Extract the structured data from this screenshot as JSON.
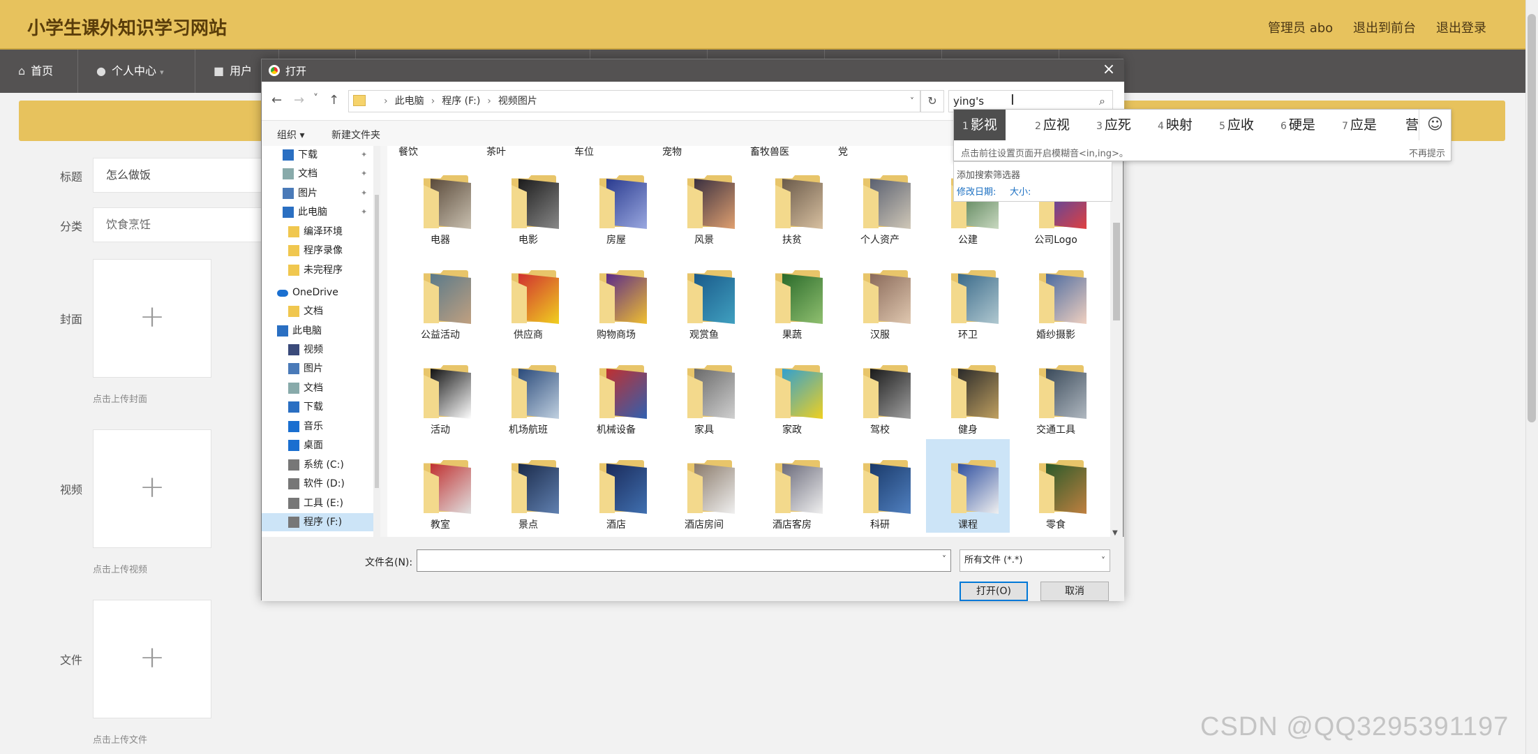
{
  "site": {
    "title": "小学生课外知识学习网站",
    "admin_label": "管理员 abo",
    "front_label": "退出到前台",
    "logout_label": "退出登录"
  },
  "nav": {
    "home": "首页",
    "personal": "个人中心",
    "users": "用户"
  },
  "form": {
    "title_label": "标题",
    "title_value": "怎么做饭",
    "category_label": "分类",
    "category_value": "饮食烹饪",
    "cover_label": "封面",
    "cover_hint": "点击上传封面",
    "video_label": "视频",
    "video_hint": "点击上传视频",
    "file_label": "文件",
    "file_hint": "点击上传文件",
    "plus": "+"
  },
  "dialog": {
    "title": "打开",
    "close": "×",
    "back": "←",
    "forward": "→",
    "recent": "˅",
    "up": "↑",
    "path": [
      "此电脑",
      "程序 (F:)",
      "视频图片"
    ],
    "path_sep": "›",
    "refresh": "↻",
    "search_value": "ying's",
    "organize": "组织 ▾",
    "new_folder": "新建文件夹",
    "sidebar": [
      {
        "label": "下载",
        "icon": "download-icon",
        "pinned": true
      },
      {
        "label": "文档",
        "icon": "document-icon",
        "pinned": true
      },
      {
        "label": "图片",
        "icon": "picture-icon",
        "pinned": true
      },
      {
        "label": "此电脑",
        "icon": "computer-icon",
        "pinned": true
      },
      {
        "label": "编泽环境",
        "icon": "folder-icon",
        "pinned": false
      },
      {
        "label": "程序录像",
        "icon": "folder-icon",
        "pinned": false
      },
      {
        "label": "未完程序",
        "icon": "folder-icon",
        "pinned": false
      },
      {
        "label": "OneDrive",
        "icon": "cloud-icon",
        "pinned": false
      },
      {
        "label": "文档",
        "icon": "folder-icon",
        "pinned": false
      },
      {
        "label": "此电脑",
        "icon": "computer-icon",
        "pinned": false
      },
      {
        "label": "视频",
        "icon": "video-icon",
        "pinned": false
      },
      {
        "label": "图片",
        "icon": "picture-icon",
        "pinned": false
      },
      {
        "label": "文档",
        "icon": "document-icon",
        "pinned": false
      },
      {
        "label": "下载",
        "icon": "download-icon",
        "pinned": false
      },
      {
        "label": "音乐",
        "icon": "music-icon",
        "pinned": false
      },
      {
        "label": "桌面",
        "icon": "desktop-icon",
        "pinned": false
      },
      {
        "label": "系统 (C:)",
        "icon": "drive-icon",
        "pinned": false
      },
      {
        "label": "软件 (D:)",
        "icon": "drive-icon",
        "pinned": false
      },
      {
        "label": "工具 (E:)",
        "icon": "drive-icon",
        "pinned": false
      },
      {
        "label": "程序 (F:)",
        "icon": "drive-icon",
        "pinned": false
      }
    ],
    "top_row": [
      "餐饮",
      "茶叶",
      "车位",
      "宠物",
      "畜牧兽医",
      "党"
    ],
    "folders": [
      {
        "name": "电器",
        "c1": "#5a4a3a",
        "c2": "#c9c0b0"
      },
      {
        "name": "电影",
        "c1": "#1b1b1b",
        "c2": "#888888"
      },
      {
        "name": "房屋",
        "c1": "#2a3b8f",
        "c2": "#9aa8e0"
      },
      {
        "name": "风景",
        "c1": "#3a3040",
        "c2": "#e0a070"
      },
      {
        "name": "扶贫",
        "c1": "#6a5a4a",
        "c2": "#d8c0a0"
      },
      {
        "name": "个人资产",
        "c1": "#5a6070",
        "c2": "#d0c8b8"
      },
      {
        "name": "公建",
        "c1": "#3a6a3a",
        "c2": "#c8d8c0"
      },
      {
        "name": "公司Logo",
        "c1": "#2a4ac0",
        "c2": "#e04040"
      },
      {
        "name": "公益活动",
        "c1": "#5a7a8a",
        "c2": "#c0a080"
      },
      {
        "name": "供应商",
        "c1": "#d03030",
        "c2": "#f0d020"
      },
      {
        "name": "购物商场",
        "c1": "#5a2a8a",
        "c2": "#f0c030"
      },
      {
        "name": "观赏鱼",
        "c1": "#1a5a8a",
        "c2": "#40a0c0"
      },
      {
        "name": "果蔬",
        "c1": "#2a6a2a",
        "c2": "#90c070"
      },
      {
        "name": "汉服",
        "c1": "#8a6a5a",
        "c2": "#e0c8b0"
      },
      {
        "name": "环卫",
        "c1": "#3a6a8a",
        "c2": "#b0c8d0"
      },
      {
        "name": "婚纱摄影",
        "c1": "#4a6aa0",
        "c2": "#f0d0c0"
      },
      {
        "name": "活动",
        "c1": "#111111",
        "c2": "#ffffff"
      },
      {
        "name": "机场航班",
        "c1": "#2a4a7a",
        "c2": "#c0d0e0"
      },
      {
        "name": "机械设备",
        "c1": "#c03030",
        "c2": "#3060b0"
      },
      {
        "name": "家具",
        "c1": "#6a6a6a",
        "c2": "#d0d0d0"
      },
      {
        "name": "家政",
        "c1": "#30a0d0",
        "c2": "#f0d020"
      },
      {
        "name": "驾校",
        "c1": "#1a1a1a",
        "c2": "#a0a0a0"
      },
      {
        "name": "健身",
        "c1": "#2a2a2a",
        "c2": "#c0a060"
      },
      {
        "name": "交通工具",
        "c1": "#3a4a5a",
        "c2": "#b0b8c0"
      },
      {
        "name": "教室",
        "c1": "#c03030",
        "c2": "#e0e0e0"
      },
      {
        "name": "景点",
        "c1": "#1a2a4a",
        "c2": "#6080b0"
      },
      {
        "name": "酒店",
        "c1": "#1a2a5a",
        "c2": "#4070b0"
      },
      {
        "name": "酒店房间",
        "c1": "#8a7a6a",
        "c2": "#f0f0f0"
      },
      {
        "name": "酒店客房",
        "c1": "#6a6a7a",
        "c2": "#f0f0f0"
      },
      {
        "name": "科研",
        "c1": "#1a3a6a",
        "c2": "#5080c0"
      },
      {
        "name": "课程",
        "c1": "#3050a0",
        "c2": "#f0f0f0"
      },
      {
        "name": "零食",
        "c1": "#2a5a2a",
        "c2": "#c08040"
      }
    ],
    "filename_label": "文件名(N):",
    "filename_value": "",
    "filetype_value": "所有文件 (*.*)",
    "open_label": "打开(O)",
    "cancel_label": "取消"
  },
  "ime": {
    "candidates": [
      {
        "n": "1",
        "text": "影视"
      },
      {
        "n": "2",
        "text": "应视"
      },
      {
        "n": "3",
        "text": "应死"
      },
      {
        "n": "4",
        "text": "映射"
      },
      {
        "n": "5",
        "text": "应收"
      },
      {
        "n": "6",
        "text": "硬是"
      },
      {
        "n": "7",
        "text": "应是"
      },
      {
        "n": "",
        "text": "营"
      }
    ],
    "emoji": "☺",
    "tip": "点击前往设置页面开启模糊音<in,ing>。",
    "no_more": "不再提示",
    "filter_title": "添加搜索筛选器",
    "filter_date": "修改日期:",
    "filter_size": "大小:"
  },
  "watermark": "CSDN @QQ3295391197"
}
